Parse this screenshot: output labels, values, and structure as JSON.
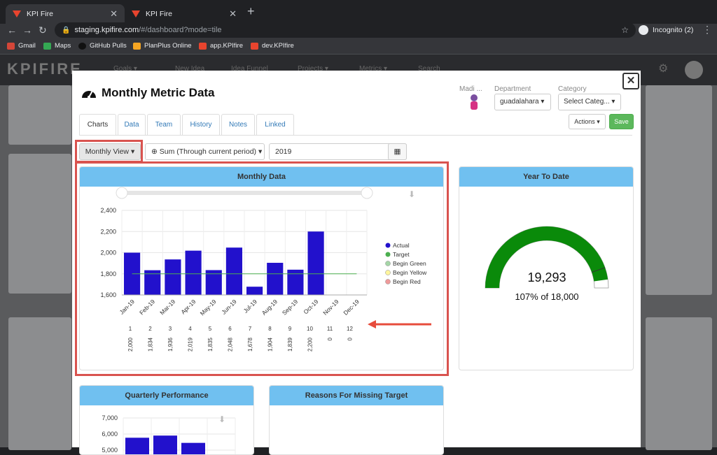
{
  "browser": {
    "tabs": [
      {
        "title": "KPI Fire"
      },
      {
        "title": "KPI Fire"
      }
    ],
    "url_host": "staging.kpifire.com",
    "url_path": "/#/dashboard?mode=tile",
    "profile": "Incognito (2)",
    "bookmarks": [
      "Gmail",
      "Maps",
      "GitHub Pulls",
      "PlanPlus Online",
      "app.KPIfire",
      "dev.KPIfire"
    ]
  },
  "app": {
    "logo": "KPIFIRE",
    "nav": [
      "Goals ▾",
      "New Idea",
      "Idea Funnel",
      "Projects ▾",
      "Metrics ▾",
      "Search"
    ]
  },
  "modal": {
    "title": "Monthly Metric Data",
    "owner_label": "Madi ...",
    "department_label": "Department",
    "department_value": "guadalahara",
    "category_label": "Category",
    "category_value": "Select Categ...",
    "tabs": [
      "Charts",
      "Data",
      "Team",
      "History",
      "Notes",
      "Linked"
    ],
    "actions_label": "Actions",
    "save_label": "Save",
    "view_select": "Monthly View",
    "aggregation_select": "Sum (Through current period)",
    "year_input": "2019"
  },
  "panels": {
    "monthly_title": "Monthly Data",
    "ytd_title": "Year To Date",
    "ytd_value": "19,293",
    "ytd_subtitle": "107% of 18,000",
    "ytd_fraction": 1.07,
    "quarterly_title": "Quarterly Performance",
    "reasons_title": "Reasons For Missing Target"
  },
  "chart_data": [
    {
      "type": "bar",
      "title": "Monthly Data",
      "categories": [
        "Jan-19",
        "Feb-19",
        "Mar-19",
        "Apr-19",
        "May-19",
        "Jun-19",
        "Jul-19",
        "Aug-19",
        "Sep-19",
        "Oct-19",
        "Nov-19",
        "Dec-19"
      ],
      "series": [
        {
          "name": "Actual",
          "values": [
            2000,
            1834,
            1936,
            2019,
            1835,
            2048,
            1678,
            1904,
            1839,
            2200,
            0,
            0
          ],
          "color": "#2211cc"
        },
        {
          "name": "Target",
          "values": [
            1800,
            1800,
            1800,
            1800,
            1800,
            1800,
            1800,
            1800,
            1800,
            1800,
            1800,
            1800
          ],
          "color": "#4caf50"
        }
      ],
      "legend": [
        "Actual",
        "Target",
        "Begin Green",
        "Begin Yellow",
        "Begin Red"
      ],
      "legend_colors": [
        "#2211cc",
        "#4caf50",
        "#a5d6a7",
        "#fff59d",
        "#ef9a9a"
      ],
      "yticks": [
        "2,400",
        "2,200",
        "2,000",
        "1,800",
        "1,600"
      ],
      "ylim": [
        1600,
        2400
      ],
      "table_index": [
        "1",
        "2",
        "3",
        "4",
        "5",
        "6",
        "7",
        "8",
        "9",
        "10",
        "11",
        "12"
      ],
      "table_values": [
        "2,000",
        "1,834",
        "1,936",
        "2,019",
        "1,835",
        "2,048",
        "1,678",
        "1,904",
        "1,839",
        "2,200",
        "0",
        "0"
      ],
      "legend_position": "right",
      "grid": true
    },
    {
      "type": "bar",
      "title": "Quarterly Performance",
      "yticks": [
        "7,000",
        "6,000",
        "5,000"
      ],
      "ylim": [
        5000,
        7000
      ],
      "values": [
        5770,
        5904,
        5450
      ],
      "color": "#2211cc"
    }
  ]
}
